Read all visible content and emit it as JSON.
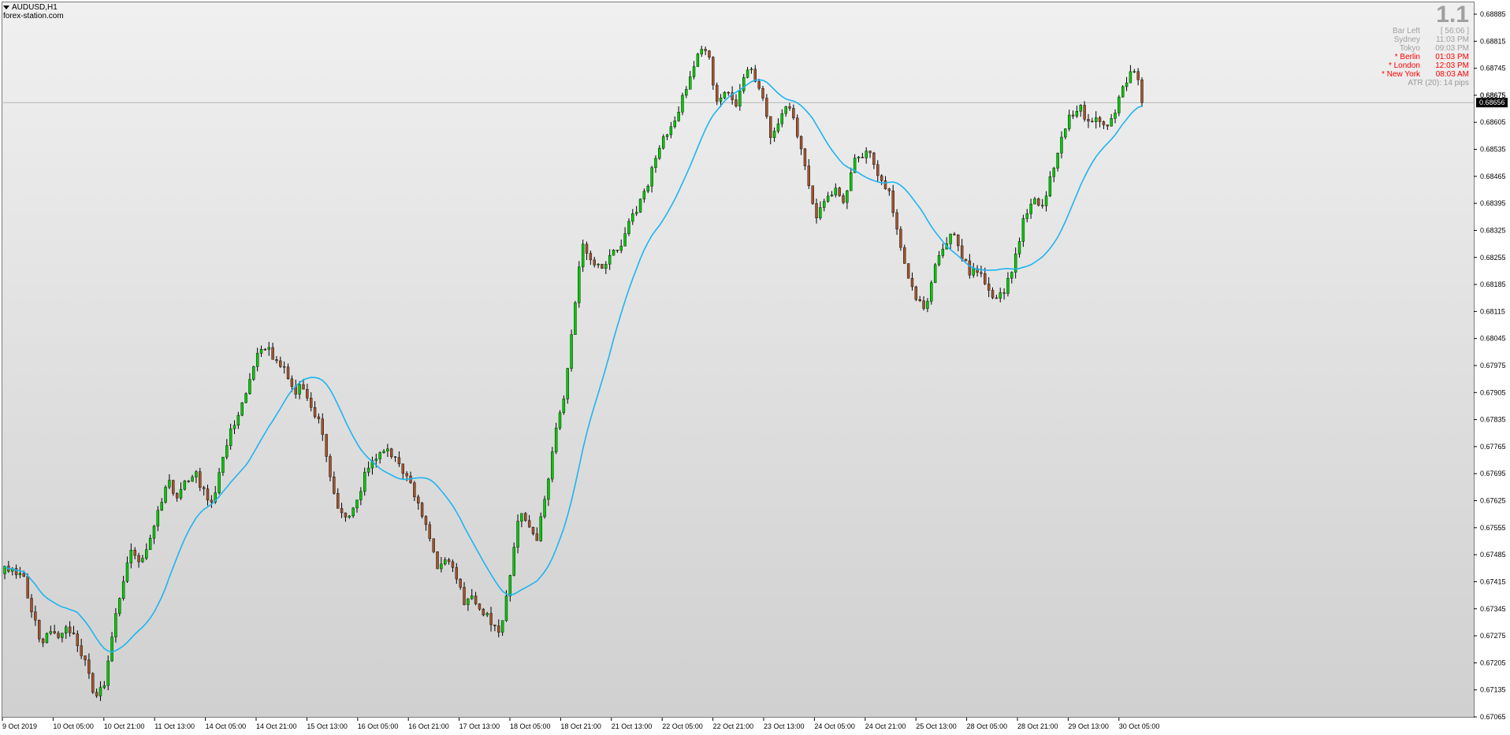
{
  "window": {
    "symbol": "AUDUSD,H1",
    "watermark": "forex-station.com"
  },
  "info_panel": {
    "version": "1.1",
    "rows": [
      {
        "label": "Bar Left",
        "value": "[ 56:06 ]",
        "color": "#a0a0a0"
      },
      {
        "label": "Sydney",
        "value": "11:03 PM",
        "color": "#a0a0a0"
      },
      {
        "label": "Tokyo",
        "value": "09:03 PM",
        "color": "#a0a0a0"
      },
      {
        "label": "* Berlin",
        "value": "01:03 PM",
        "color": "#ff0000"
      },
      {
        "label": "* London",
        "value": "12:03 PM",
        "color": "#ff0000"
      },
      {
        "label": "* New York",
        "value": "08:03 AM",
        "color": "#ff0000"
      }
    ],
    "atr": "ATR (20): 14 pips"
  },
  "colors": {
    "bull": "#00c800",
    "bear": "#a0522d",
    "wick": "#000000",
    "ma": "#1eb4f0",
    "price_line": "#b4b4b4",
    "price_tag_bg": "#000000",
    "price_tag_text": "#ffffff"
  },
  "chart_data": {
    "type": "candlestick",
    "symbol": "AUDUSD",
    "timeframe": "H1",
    "ylim": [
      0.67065,
      0.68885
    ],
    "y_ticks": [
      "0.68885",
      "0.68815",
      "0.68745",
      "0.68675",
      "0.68605",
      "0.68535",
      "0.68465",
      "0.68395",
      "0.68325",
      "0.68255",
      "0.68185",
      "0.68115",
      "0.68045",
      "0.67975",
      "0.67905",
      "0.67835",
      "0.67765",
      "0.67695",
      "0.67625",
      "0.67555",
      "0.67485",
      "0.67415",
      "0.67345",
      "0.67275",
      "0.67205",
      "0.67135",
      "0.67065"
    ],
    "x_ticks": [
      "9 Oct 2019",
      "10 Oct 05:00",
      "10 Oct 21:00",
      "11 Oct 13:00",
      "14 Oct 05:00",
      "14 Oct 21:00",
      "15 Oct 13:00",
      "16 Oct 05:00",
      "16 Oct 21:00",
      "17 Oct 13:00",
      "18 Oct 05:00",
      "18 Oct 21:00",
      "21 Oct 13:00",
      "22 Oct 05:00",
      "22 Oct 21:00",
      "23 Oct 13:00",
      "24 Oct 05:00",
      "24 Oct 21:00",
      "25 Oct 13:00",
      "28 Oct 05:00",
      "28 Oct 21:00",
      "29 Oct 13:00",
      "30 Oct 05:00"
    ],
    "current_price": "0.68656",
    "price_marker_above": "0.68675",
    "close_path": [
      0.6746,
      0.6744,
      0.6743,
      0.6734,
      0.6726,
      0.6728,
      0.6727,
      0.673,
      0.6726,
      0.672,
      0.6712,
      0.6715,
      0.6729,
      0.674,
      0.675,
      0.6747,
      0.6752,
      0.676,
      0.6768,
      0.6763,
      0.6767,
      0.677,
      0.6765,
      0.6762,
      0.6772,
      0.678,
      0.6786,
      0.6792,
      0.68,
      0.6803,
      0.6798,
      0.6796,
      0.679,
      0.6793,
      0.6786,
      0.6782,
      0.677,
      0.676,
      0.6757,
      0.6762,
      0.677,
      0.6773,
      0.6776,
      0.6774,
      0.6771,
      0.6766,
      0.676,
      0.6754,
      0.6745,
      0.6748,
      0.6742,
      0.6736,
      0.6737,
      0.6734,
      0.6731,
      0.6728,
      0.6744,
      0.676,
      0.6756,
      0.6753,
      0.6765,
      0.678,
      0.679,
      0.681,
      0.683,
      0.6825,
      0.6822,
      0.6826,
      0.6828,
      0.6833,
      0.6838,
      0.6843,
      0.685,
      0.6856,
      0.686,
      0.6866,
      0.6873,
      0.688,
      0.6877,
      0.6865,
      0.687,
      0.6864,
      0.6874,
      0.6873,
      0.6866,
      0.6856,
      0.6863,
      0.6865,
      0.6855,
      0.6845,
      0.6836,
      0.684,
      0.6843,
      0.684,
      0.685,
      0.6852,
      0.6853,
      0.6845,
      0.6842,
      0.683,
      0.682,
      0.6815,
      0.6813,
      0.6822,
      0.6829,
      0.6832,
      0.6826,
      0.6821,
      0.6823,
      0.6817,
      0.6815,
      0.6818,
      0.6826,
      0.6836,
      0.684,
      0.6838,
      0.6848,
      0.6855,
      0.6862,
      0.6865,
      0.686,
      0.6863,
      0.6858,
      0.6863,
      0.687,
      0.6874,
      0.6868
    ]
  }
}
